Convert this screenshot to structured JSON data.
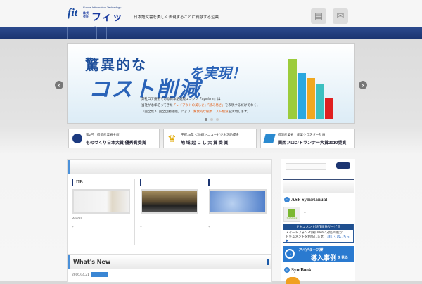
{
  "header": {
    "logo_top": "Future Information Technology",
    "logo_kk": "株式会社",
    "logo_name": "フィット",
    "logo_f": "fit",
    "tagline": "日本語文書を美しく表現することに貢献する企業",
    "icons": [
      "document-icon",
      "mail-icon"
    ]
  },
  "slider": {
    "line1": "驚異的な",
    "line2": "コスト削減",
    "line3": "を実現！",
    "text1": "弊社コア技術である日本語組版エンジン「Symform」は",
    "text2a": "当社が永年培ってきた",
    "text2b": "「レイアウトの美しさ」「読み易さ」",
    "text2c": "を表現するだけでなく、",
    "text3a": "「完全無人･完全自動組版」により、",
    "text3b": "驚異的な編集コスト削減",
    "text3c": "を実現します。",
    "prev": "‹",
    "next": "›"
  },
  "awards": [
    {
      "line1": "第2回　経済産業省主催",
      "line2": "ものづくり日本大賞 優秀賞受賞"
    },
    {
      "line1": "平成18年 ＜池銀＞ニュービジネス助成金",
      "line2": "地 域 起 こ し 大 賞 受 賞"
    },
    {
      "line1": "経済産業省　産業クラスター計画",
      "line2": "関西フロントランナー大賞2010受賞"
    }
  ],
  "main": {
    "columns": [
      {
        "title": "DB",
        "caption": "Web90",
        "note": "+"
      },
      {
        "title": "",
        "caption": "",
        "note": "+"
      },
      {
        "title": "",
        "caption": "",
        "note": "+"
      }
    ]
  },
  "news": {
    "title": "What's New",
    "items": [
      {
        "date": "2016.04.21"
      }
    ]
  },
  "sidebar": {
    "sections": [
      {
        "title": "ASP SymManual",
        "note": "+",
        "thumb_label": "SymManual"
      },
      {
        "title": "SymBook"
      }
    ],
    "ad1": {
      "header": "ドキュメント制作請負サービス",
      "line1": "スマートフォン･印刷･Webに対応可能な",
      "line2": "ドキュメントを制作します。",
      "link": "詳しくはこちら ▶"
    },
    "ad2": {
      "line1": "アパグループ様",
      "line2": "導入事例",
      "line3": "を見る"
    }
  },
  "colors": {
    "nav": "#1c3571",
    "accent": "#3a86d4"
  }
}
